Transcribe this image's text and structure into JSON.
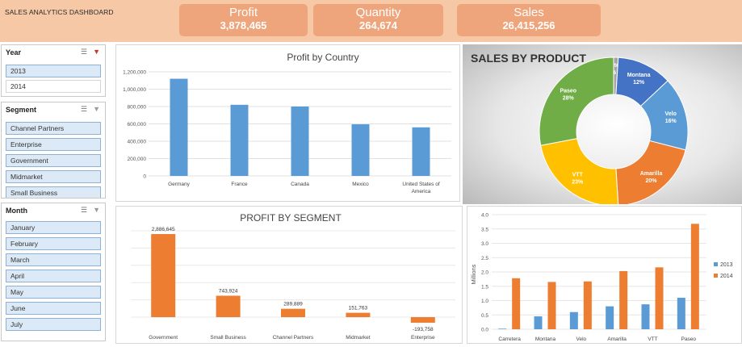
{
  "dashboard": {
    "title": "SALES ANALYTICS DASHBOARD"
  },
  "kpis": [
    {
      "label": "Profit",
      "value": "3,878,465"
    },
    {
      "label": "Quantity",
      "value": "264,674"
    },
    {
      "label": "Sales",
      "value": "26,415,256"
    }
  ],
  "slicers": {
    "year": {
      "title": "Year",
      "items": [
        "2013",
        "2014"
      ]
    },
    "segment": {
      "title": "Segment",
      "items": [
        "Channel Partners",
        "Enterprise",
        "Government",
        "Midmarket",
        "Small Business"
      ]
    },
    "month": {
      "title": "Month",
      "items": [
        "January",
        "February",
        "March",
        "April",
        "May",
        "June",
        "July"
      ]
    }
  },
  "icons": {
    "multi_select": "multi-select-icon",
    "clear_filter": "clear-filter-icon"
  },
  "colors": {
    "header_bg": "#f6c8a6",
    "kpi_bg": "#efa57c",
    "blue": "#5b9bd5",
    "orange": "#ed7d31",
    "green": "#70ad47",
    "yellow": "#ffc000",
    "navy": "#4472c4",
    "grey": "#a5a5a5"
  },
  "chart_data": [
    {
      "type": "bar",
      "title": "Profit by Country",
      "categories": [
        "Germany",
        "France",
        "Canada",
        "Mexico",
        "United States of America"
      ],
      "values": [
        1120000,
        820000,
        800000,
        595000,
        560000
      ],
      "ylim": [
        0,
        1200000
      ],
      "yticks": [
        "0",
        "200,000",
        "400,000",
        "600,000",
        "800,000",
        "1,000,000",
        "1,200,000"
      ],
      "color": "#5b9bd5",
      "grid": true
    },
    {
      "type": "pie",
      "title": "SALES BY PRODUCT",
      "donut": true,
      "slices": [
        {
          "label": "Carretera",
          "pct": "1%",
          "value": 1,
          "color": "#a5a5a5"
        },
        {
          "label": "Montana",
          "pct": "12%",
          "value": 12,
          "color": "#4472c4"
        },
        {
          "label": "Velo",
          "pct": "16%",
          "value": 16,
          "color": "#5b9bd5"
        },
        {
          "label": "Amarilla",
          "pct": "20%",
          "value": 20,
          "color": "#ed7d31"
        },
        {
          "label": "VTT",
          "pct": "23%",
          "value": 23,
          "color": "#ffc000"
        },
        {
          "label": "Paseo",
          "pct": "28%",
          "value": 28,
          "color": "#70ad47"
        }
      ]
    },
    {
      "type": "bar",
      "title": "PROFIT BY SEGMENT",
      "categories": [
        "Government",
        "Small Business",
        "Channel Partners",
        "Midmarket",
        "Enterprise"
      ],
      "values": [
        2886645,
        743924,
        289889,
        151763,
        -193758
      ],
      "labels": [
        "2,886,645",
        "743,924",
        "289,889",
        "151,763",
        "-193,758"
      ],
      "color": "#ed7d31",
      "grid": true
    },
    {
      "type": "bar",
      "ylabel": "Millions",
      "categories": [
        "Carretera",
        "Montana",
        "Velo",
        "Amarilla",
        "VTT",
        "Paseo"
      ],
      "series": [
        {
          "name": "2013",
          "values": [
            0.02,
            0.45,
            0.6,
            0.8,
            0.87,
            1.1
          ],
          "color": "#5b9bd5"
        },
        {
          "name": "2014",
          "values": [
            1.78,
            1.65,
            1.67,
            2.03,
            2.16,
            3.68
          ],
          "color": "#ed7d31"
        }
      ],
      "ylim": [
        0,
        4
      ],
      "yticks": [
        "0.0",
        "0.5",
        "1.0",
        "1.5",
        "2.0",
        "2.5",
        "3.0",
        "3.5",
        "4.0"
      ],
      "legend": "right",
      "grid": true
    }
  ]
}
